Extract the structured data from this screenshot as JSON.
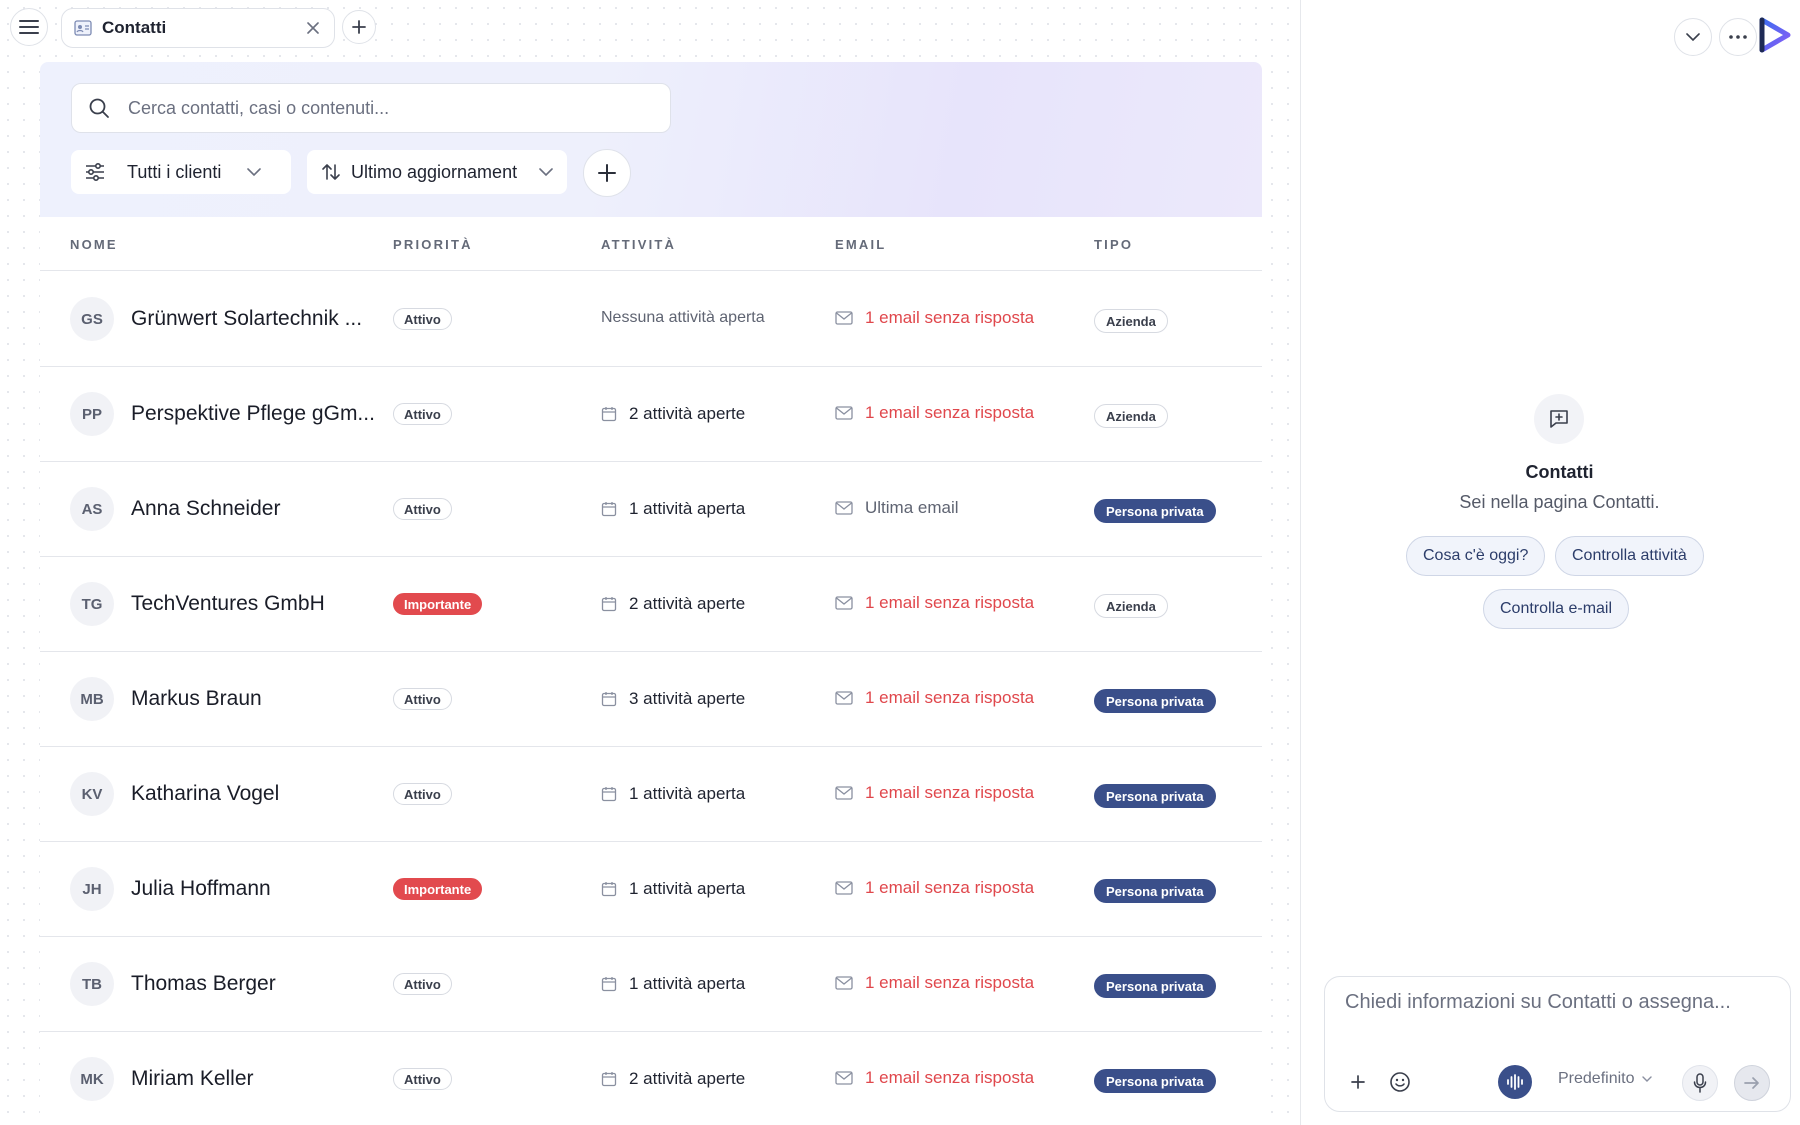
{
  "topbar": {
    "tab_label": "Contatti"
  },
  "search": {
    "placeholder": "Cerca contatti, casi o contenuti..."
  },
  "filters": {
    "client_filter": "Tutti i clienti",
    "sort": "Ultimo aggiornament"
  },
  "table": {
    "headers": [
      "NOME",
      "PRIORITÀ",
      "ATTIVITÀ",
      "EMAIL",
      "TIPO"
    ],
    "rows": [
      {
        "initials": "GS",
        "name": "Grünwert Solartechnik ...",
        "priority": "Attivo",
        "priority_kind": "attivo",
        "activity": "Nessuna attività aperta",
        "activity_kind": "none",
        "email": "1 email senza risposta",
        "email_kind": "unread",
        "type": "Azienda",
        "type_kind": "azienda"
      },
      {
        "initials": "PP",
        "name": "Perspektive Pflege gGm...",
        "priority": "Attivo",
        "priority_kind": "attivo",
        "activity": "2 attività aperte",
        "activity_kind": "open",
        "email": "1 email senza risposta",
        "email_kind": "unread",
        "type": "Azienda",
        "type_kind": "azienda"
      },
      {
        "initials": "AS",
        "name": "Anna Schneider",
        "priority": "Attivo",
        "priority_kind": "attivo",
        "activity": "1 attività aperta",
        "activity_kind": "open",
        "email": "Ultima email",
        "email_kind": "read",
        "type": "Persona privata",
        "type_kind": "privata"
      },
      {
        "initials": "TG",
        "name": "TechVentures GmbH",
        "priority": "Importante",
        "priority_kind": "importante",
        "activity": "2 attività aperte",
        "activity_kind": "open",
        "email": "1 email senza risposta",
        "email_kind": "unread",
        "type": "Azienda",
        "type_kind": "azienda"
      },
      {
        "initials": "MB",
        "name": "Markus Braun",
        "priority": "Attivo",
        "priority_kind": "attivo",
        "activity": "3 attività aperte",
        "activity_kind": "open",
        "email": "1 email senza risposta",
        "email_kind": "unread",
        "type": "Persona privata",
        "type_kind": "privata"
      },
      {
        "initials": "KV",
        "name": "Katharina Vogel",
        "priority": "Attivo",
        "priority_kind": "attivo",
        "activity": "1 attività aperta",
        "activity_kind": "open",
        "email": "1 email senza risposta",
        "email_kind": "unread",
        "type": "Persona privata",
        "type_kind": "privata"
      },
      {
        "initials": "JH",
        "name": "Julia Hoffmann",
        "priority": "Importante",
        "priority_kind": "importante",
        "activity": "1 attività aperta",
        "activity_kind": "open",
        "email": "1 email senza risposta",
        "email_kind": "unread",
        "type": "Persona privata",
        "type_kind": "privata"
      },
      {
        "initials": "TB",
        "name": "Thomas Berger",
        "priority": "Attivo",
        "priority_kind": "attivo",
        "activity": "1 attività aperta",
        "activity_kind": "open",
        "email": "1 email senza risposta",
        "email_kind": "unread",
        "type": "Persona privata",
        "type_kind": "privata"
      },
      {
        "initials": "MK",
        "name": "Miriam Keller",
        "priority": "Attivo",
        "priority_kind": "attivo",
        "activity": "2 attività aperte",
        "activity_kind": "open",
        "email": "1 email senza risposta",
        "email_kind": "unread",
        "type": "Persona privata",
        "type_kind": "privata"
      }
    ]
  },
  "assistant": {
    "title": "Contatti",
    "subtitle": "Sei nella pagina Contatti.",
    "chips": [
      "Cosa c'è oggi?",
      "Controlla attività",
      "Controlla e-mail"
    ],
    "composer_placeholder": "Chiedi informazioni su Contatti o assegna...",
    "model": "Predefinito"
  },
  "colors": {
    "accent_navy": "#3a4f8a",
    "alert_red": "#e24a4e",
    "hero_gradient": "#eef1fd"
  },
  "icons": [
    "menu-icon",
    "contacts-tab-icon",
    "close-icon",
    "plus-icon",
    "chevron-down-icon",
    "more-icon",
    "app-logo",
    "search-icon",
    "sliders-icon",
    "sort-icon",
    "calendar-icon",
    "mail-icon",
    "chat-plus-icon",
    "emoji-icon",
    "voice-wave-icon",
    "microphone-icon",
    "send-icon"
  ]
}
